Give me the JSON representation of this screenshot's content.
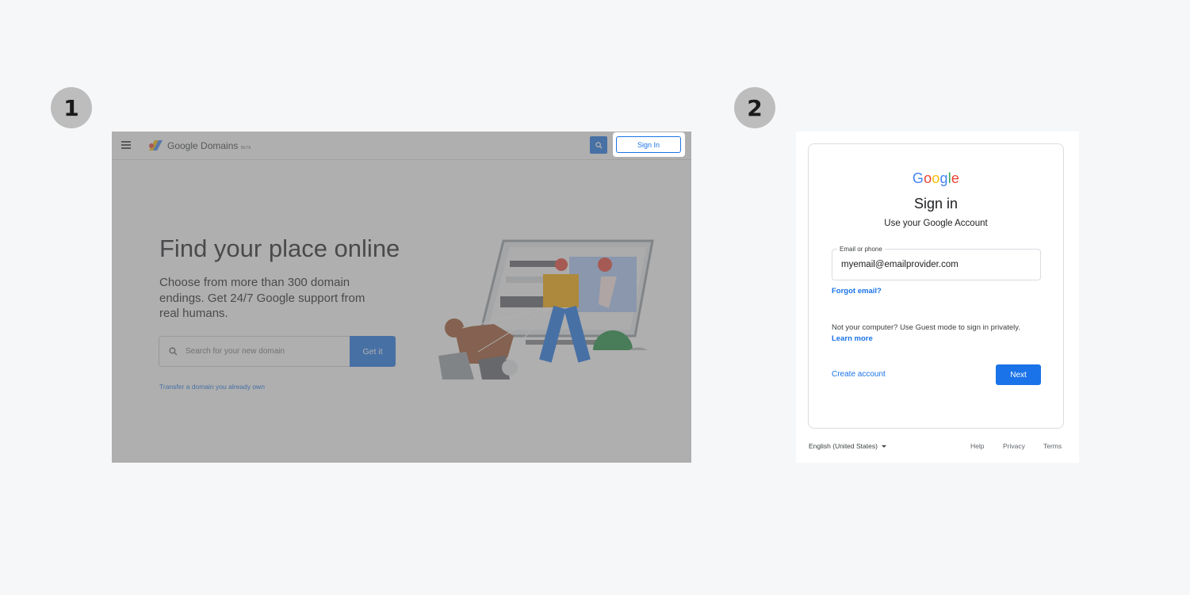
{
  "steps": [
    "1",
    "2"
  ],
  "domains_page": {
    "brand": "Google Domains",
    "brand_suffix": "BETA",
    "sign_in_button": "Sign In",
    "hero_title": "Find your place online",
    "hero_subtitle": "Choose from more than 300 domain endings. Get 24/7 Google support from real humans.",
    "search_placeholder": "Search for your new domain",
    "get_it_button": "Get it",
    "transfer_link": "Transfer a domain you already own",
    "icons": [
      "menu-icon",
      "google-domains-logo-icon",
      "search-icon"
    ]
  },
  "signin_page": {
    "logo_letters": [
      "G",
      "o",
      "o",
      "g",
      "l",
      "e"
    ],
    "title": "Sign in",
    "subtitle": "Use your Google Account",
    "email_label": "Email or phone",
    "email_value": "myemail@emailprovider.com",
    "forgot_email": "Forgot email?",
    "guest_notice": "Not your computer? Use Guest mode to sign in privately.",
    "learn_more": "Learn more",
    "create_account": "Create account",
    "next_button": "Next",
    "language": "English (United States)",
    "footer_links": {
      "help": "Help",
      "privacy": "Privacy",
      "terms": "Terms"
    }
  },
  "colors": {
    "accent_blue": "#1a73e8",
    "step_circle": "#bdbdbd",
    "background": "#f6f7f9",
    "overlay": "rgba(110,110,110,0.55)"
  }
}
